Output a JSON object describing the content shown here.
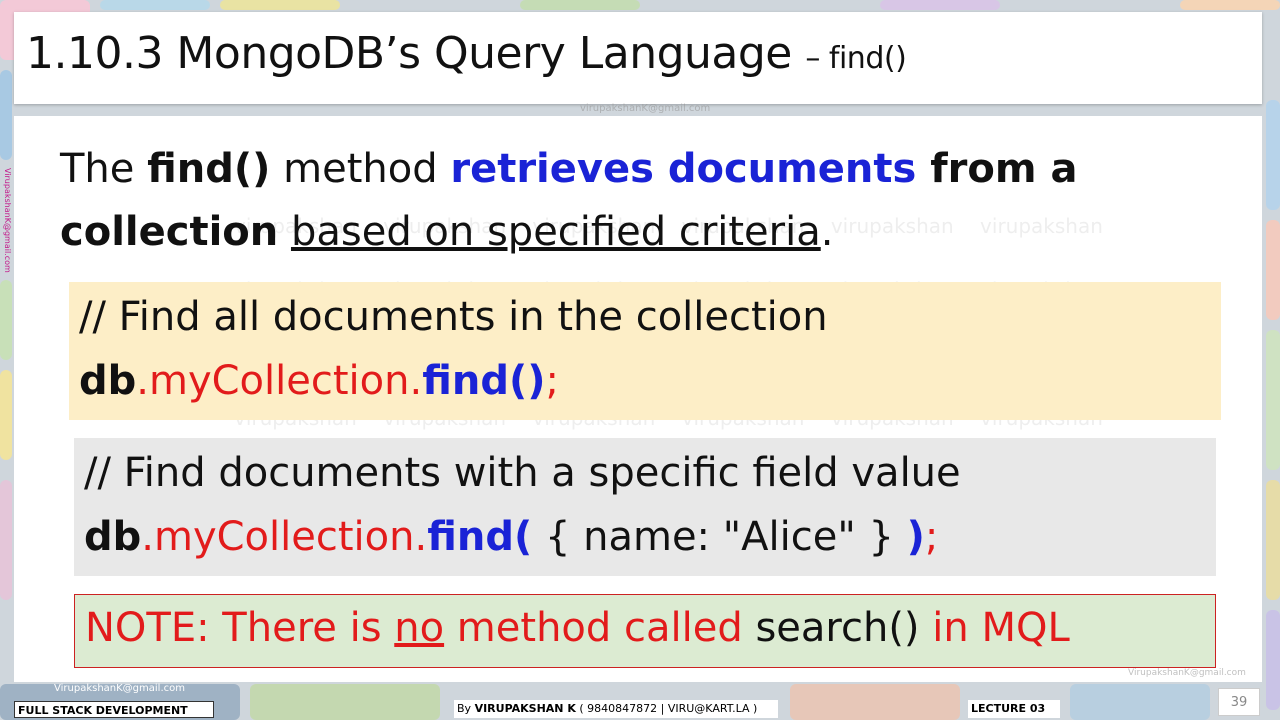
{
  "title": {
    "main": "1.10.3 MongoDB’s Query Language",
    "sub": "– find()"
  },
  "intro": {
    "t1": "The ",
    "t2": "find()",
    "t3": " method ",
    "t4": "retrieves documents",
    "t5": " from a collection",
    "t6": " ",
    "t7": "based on specified criteria",
    "t8": "."
  },
  "code1": {
    "comment": "// Find all documents in the collection",
    "db": "db",
    "coll": ".myCollection.",
    "fn": "find()",
    "end": ";"
  },
  "code2": {
    "comment": "// Find documents with a specific field value",
    "db": "db",
    "coll": ".myCollection.",
    "fn": "find(",
    "args": " { name: \"Alice\" } ",
    "close": ")",
    "end": ";"
  },
  "note": {
    "p1": "NOTE:  There is ",
    "p2": "no",
    "p3": " method called ",
    "p4": "search()",
    "p5": " in MQL"
  },
  "watermark": "virupakshan virupakshan virupakshan virupakshan virupakshan virupakshan",
  "emails": {
    "top": "virupakshanK@gmail.com",
    "side": "VirupakshanK@gmail.com",
    "bottom": "VirupakshanK@gmail.com",
    "right": "VirupakshanK@gmail.com"
  },
  "footer": {
    "course": "FULL STACK DEVELOPMENT",
    "by_prefix": "By ",
    "author": "VIRUPAKSHAN K",
    "contact": " ( 9840847872 | VIRU@KART.LA )",
    "lecture": "LECTURE 03",
    "page": "39"
  },
  "colors": {
    "blue": "#1a23d6",
    "red": "#e21b1b",
    "code_bg1": "#fdeec7",
    "code_bg2": "#e8e8e8",
    "note_bg": "#dcebd2"
  }
}
